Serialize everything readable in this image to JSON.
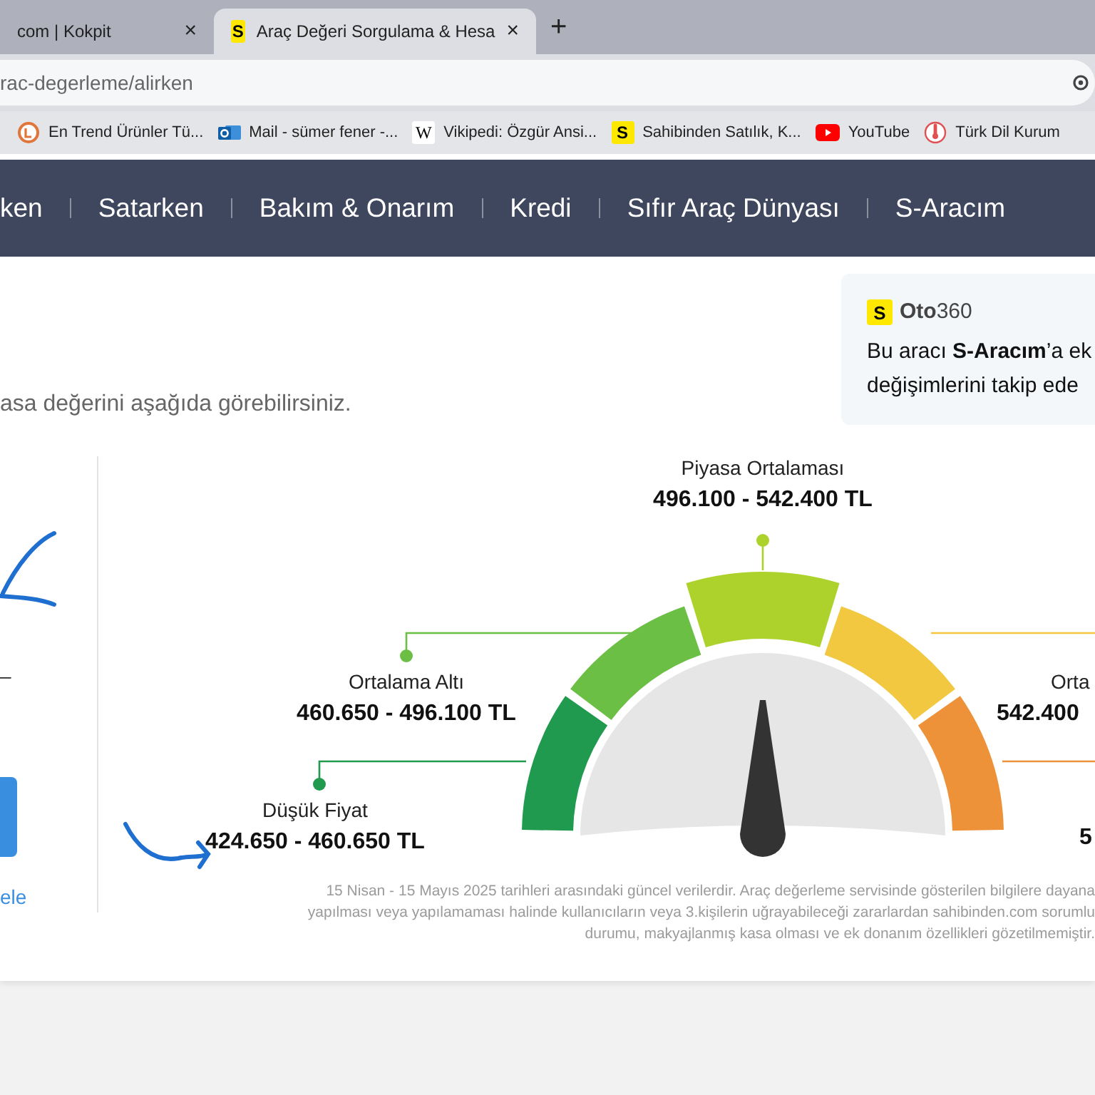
{
  "browser": {
    "tabs": [
      {
        "title": "com | Kokpit",
        "close": "×",
        "selected": false
      },
      {
        "title": "Araç Değeri Sorgulama & Hesa",
        "favicon_letter": "S",
        "close": "×",
        "selected": true
      }
    ],
    "new_tab": "+",
    "address": "rac-degerleme/alirken",
    "bookmarks": [
      {
        "kind": "ring",
        "label": "En Trend Ürünler Tü..."
      },
      {
        "kind": "mail",
        "label": "Mail - sümer fener -..."
      },
      {
        "kind": "letter",
        "letter": "W",
        "label": "Vikipedi: Özgür Ansi..."
      },
      {
        "kind": "letter-yellow",
        "letter": "S",
        "label": "Sahibinden Satılık, K..."
      },
      {
        "kind": "video",
        "label": "YouTube"
      },
      {
        "kind": "pin",
        "label": "Türk Dil Kurum"
      }
    ]
  },
  "nav": {
    "items": [
      "ken",
      "Satarken",
      "Bakım & Onarım",
      "Kredi",
      "Sıfır Araç Dünyası",
      "S-Aracım"
    ]
  },
  "promo": {
    "logo_letter": "S",
    "brand": "**Oto**360",
    "lines": [
      "Bu aracı **S-Aracım**’a ek",
      "değişimlerini takip ede"
    ]
  },
  "subtitle": "asa değerini aşağıda görebilirsiniz.",
  "left_panel": {
    "dash": "–",
    "link": "ele"
  },
  "gauge": {
    "level": 0.5,
    "ranges": [
      {
        "title": "Düşük Fiyat",
        "value": "424.650 - 460.650 TL",
        "color": "#1f9a4e",
        "selected": false
      },
      {
        "title": "Ortalama Altı",
        "value": "460.650 - 496.100 TL",
        "color": "#6cbf45",
        "selected": false
      },
      {
        "title": "Piyasa Ortalaması",
        "value": "496.100 - 542.400 TL",
        "color": "#add22b",
        "selected": true
      },
      {
        "title": "Orta",
        "value": "542.400",
        "color": "#f1c83f",
        "selected": false
      },
      {
        "value": "5",
        "color": "#ee923a",
        "selected": false
      }
    ]
  },
  "disclaimer": [
    "15 Nisan - 15 Mayıs 2025 tarihleri arasındaki güncel verilerdir. Araç değerleme servisinde gösterilen bilgilere dayana",
    "yapılması veya yapılamaması halinde kullanıcıların veya 3.kişilerin uğrayabileceği zararlardan sahibinden.com sorumlu",
    "durumu, makyajlanmış kasa olması ve ek donanım özellikleri gözetilmemiştir."
  ]
}
